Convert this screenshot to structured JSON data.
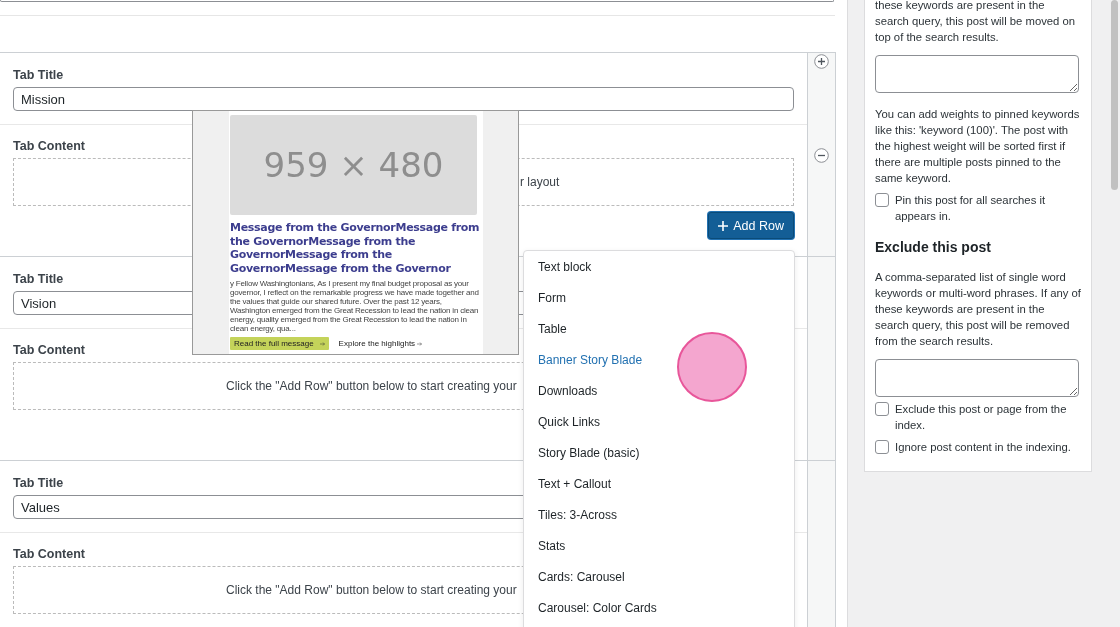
{
  "repeater": {
    "rows": [
      {
        "title_label": "Tab Title",
        "title_value": "Mission",
        "content_label": "Tab Content",
        "content_hint": "r layout",
        "add_row_button": "Add Row"
      },
      {
        "title_label": "Tab Title",
        "title_value": "Vision",
        "content_label": "Tab Content",
        "content_hint": "Click the \"Add Row\" button below to start creating your"
      },
      {
        "title_label": "Tab Title",
        "title_value": "Values",
        "content_label": "Tab Content",
        "content_hint": "Click the \"Add Row\" button below to start creating your"
      }
    ]
  },
  "layout_preview": {
    "image_size": "959 × 480",
    "heading": "Message from the GovernorMessage from the GovernorMessage from the GovernorMessage from the GovernorMessage from the Governor",
    "body": "y Fellow Washingtonians, As I present my final budget proposal as your governor, I reflect on the remarkable progress we have made together and the values that guide our shared future. Over the past 12 years, Washington emerged from the Great Recession to lead the nation in clean energy, quality emerged from the Great Recession to lead the nation in clean energy, qua...",
    "primary_button": "Read the full message",
    "secondary_link": "Explore the highlights"
  },
  "add_row_menu": {
    "items": [
      {
        "label": "Text block",
        "selected": false
      },
      {
        "label": "Form",
        "selected": false
      },
      {
        "label": "Table",
        "selected": false
      },
      {
        "label": "Banner Story Blade",
        "selected": true
      },
      {
        "label": "Downloads",
        "selected": false
      },
      {
        "label": "Quick Links",
        "selected": false
      },
      {
        "label": "Story Blade (basic)",
        "selected": false
      },
      {
        "label": "Text + Callout",
        "selected": false
      },
      {
        "label": "Tiles: 3-Across",
        "selected": false
      },
      {
        "label": "Stats",
        "selected": false
      },
      {
        "label": "Cards: Carousel",
        "selected": false
      },
      {
        "label": "Carousel: Color Cards",
        "selected": false
      }
    ]
  },
  "sidebar": {
    "items": [
      {
        "kind": "text",
        "text": "these keywords are present in the search query, this post will be moved on top of the search results."
      },
      {
        "kind": "textarea"
      },
      {
        "kind": "text",
        "text": "You can add weights to pinned keywords like this: 'keyword (100)'. The post with the highest weight will be sorted first if there are multiple posts pinned to the same keyword."
      },
      {
        "kind": "checkbox",
        "text": "Pin this post for all searches it appears in.",
        "checked": false
      },
      {
        "kind": "heading",
        "text": "Exclude this post"
      },
      {
        "kind": "text",
        "text": "A comma-separated list of single word keywords or multi-word phrases. If any of these keywords are present in the search query, this post will be removed from the search results."
      },
      {
        "kind": "textarea"
      },
      {
        "kind": "checkbox",
        "text": "Exclude this post or page from the index.",
        "checked": false
      },
      {
        "kind": "checkbox",
        "text": "Ignore post content in the indexing.",
        "checked": false
      }
    ]
  }
}
